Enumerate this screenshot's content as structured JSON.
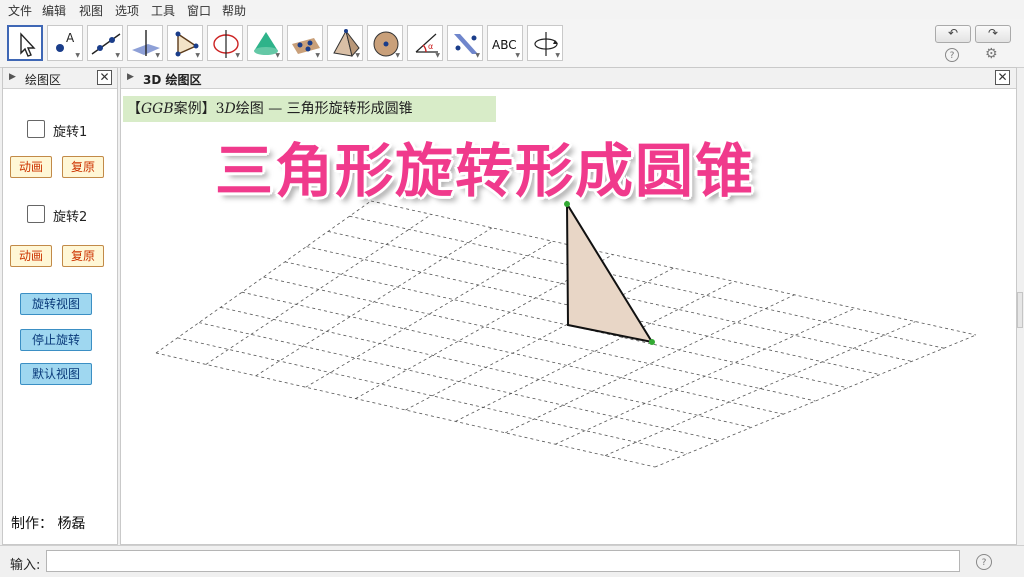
{
  "menu": [
    "文件",
    "编辑",
    "视图",
    "选项",
    "工具",
    "窗口",
    "帮助"
  ],
  "toolbar": {
    "tools": [
      {
        "icon": "move-arrow-icon"
      },
      {
        "icon": "point-icon"
      },
      {
        "icon": "line-icon"
      },
      {
        "icon": "perpendicular-plane-icon"
      },
      {
        "icon": "polygon-icon"
      },
      {
        "icon": "circle-axis-icon"
      },
      {
        "icon": "cone-icon"
      },
      {
        "icon": "plane-points-icon"
      },
      {
        "icon": "pyramid-icon"
      },
      {
        "icon": "sphere-icon"
      },
      {
        "icon": "angle-icon"
      },
      {
        "icon": "reflect-plane-icon"
      },
      {
        "icon": "text-icon",
        "label": "ABC"
      },
      {
        "icon": "rotate-view-icon"
      }
    ],
    "undo_symbol": "↶",
    "redo_symbol": "↷",
    "help_symbol": "?",
    "settings_symbol": "⚙"
  },
  "left_panel": {
    "title": "绘图区",
    "close_symbol": "✕",
    "checkbox1_label": "旋转1",
    "animate1": "动画",
    "reset1": "复原",
    "checkbox2_label": "旋转2",
    "animate2": "动画",
    "reset2": "复原",
    "rotate_view": "旋转视图",
    "stop_rotate": "停止旋转",
    "default_view": "默认视图",
    "author": "制作：  杨磊"
  },
  "main_panel": {
    "title": "3D 绘图区",
    "close_symbol": "✕",
    "banner": "【𝐺𝐺𝐵案例】3𝐷绘图 — 三角形旋转形成圆锥",
    "big_title": "三角形旋转形成圆锥",
    "triangle_fill": "#e8d6c6",
    "point_color": "#33aa33"
  },
  "input_bar": {
    "label": "输入:",
    "value": "",
    "help_symbol": "?"
  }
}
